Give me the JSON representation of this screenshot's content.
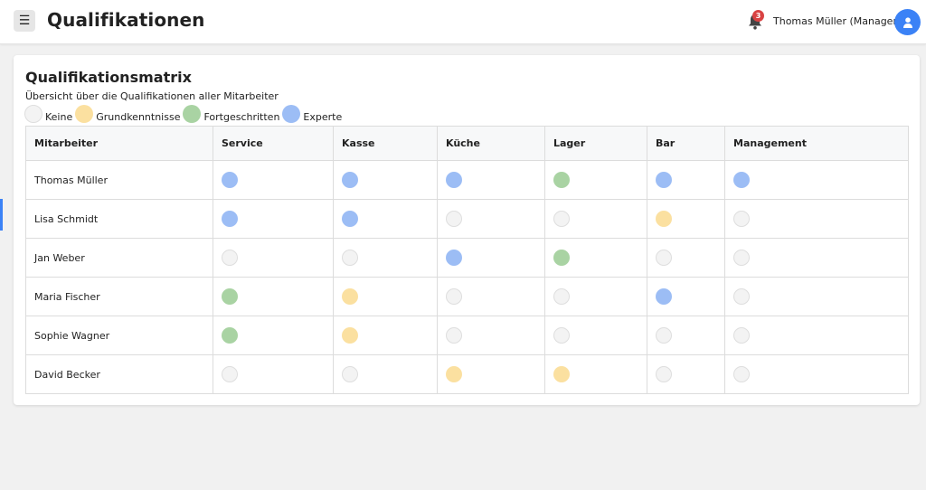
{
  "header": {
    "menu_icon": "hamburger-icon",
    "title": "Qualifikationen",
    "notifications": {
      "icon": "bell-icon",
      "count": "3"
    },
    "user_name": "Thomas Müller (Manager)",
    "avatar_icon": "user-icon"
  },
  "card": {
    "title": "Qualifikationsmatrix",
    "subtitle": "Übersicht über die Qualifikationen aller Mitarbeiter"
  },
  "legend": [
    {
      "key": "keine",
      "label": "Keine",
      "color": "#f3f3f3"
    },
    {
      "key": "grund",
      "label": "Grundkenntnisse",
      "color": "#fbe0a0"
    },
    {
      "key": "fort",
      "label": "Fortgeschritten",
      "color": "#a9d3a3"
    },
    {
      "key": "experte",
      "label": "Experte",
      "color": "#9cbdf5"
    }
  ],
  "table": {
    "columns": [
      "Mitarbeiter",
      "Service",
      "Kasse",
      "Küche",
      "Lager",
      "Bar",
      "Management"
    ],
    "rows": [
      {
        "name": "Thomas Müller",
        "levels": [
          "experte",
          "experte",
          "experte",
          "fort",
          "experte",
          "experte"
        ]
      },
      {
        "name": "Lisa Schmidt",
        "levels": [
          "experte",
          "experte",
          "keine",
          "keine",
          "grund",
          "keine"
        ]
      },
      {
        "name": "Jan Weber",
        "levels": [
          "keine",
          "keine",
          "experte",
          "fort",
          "keine",
          "keine"
        ]
      },
      {
        "name": "Maria Fischer",
        "levels": [
          "fort",
          "grund",
          "keine",
          "keine",
          "experte",
          "keine"
        ]
      },
      {
        "name": "Sophie Wagner",
        "levels": [
          "fort",
          "grund",
          "keine",
          "keine",
          "keine",
          "keine"
        ]
      },
      {
        "name": "David Becker",
        "levels": [
          "keine",
          "keine",
          "grund",
          "grund",
          "keine",
          "keine"
        ]
      }
    ]
  },
  "colors": {
    "accent": "#3b82f6",
    "badge": "#d94343"
  }
}
